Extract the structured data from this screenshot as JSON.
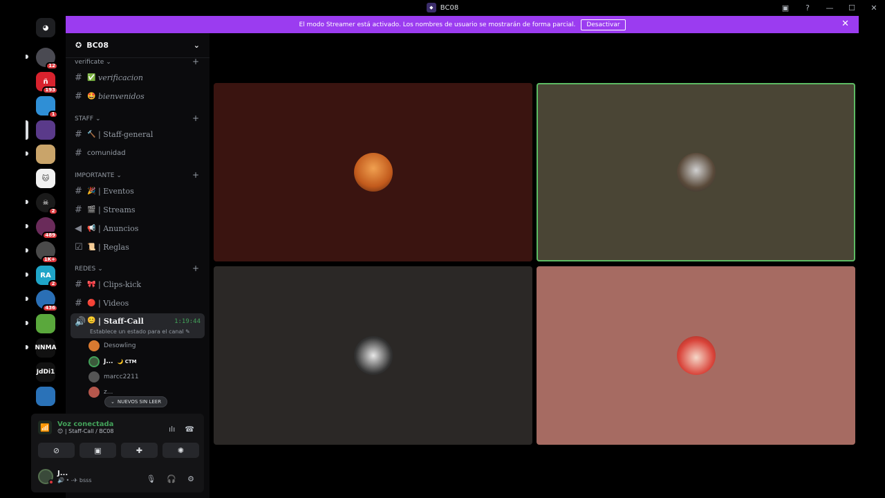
{
  "window": {
    "title": "BC08",
    "app_icon": "discord-server-icon"
  },
  "banner": {
    "text": "El modo Streamer está activado. Los nombres de usuario se mostrarán de forma parcial.",
    "button": "Desactivar",
    "color": "#9b3cf0"
  },
  "guilds": [
    {
      "name": "direct-messages",
      "label": "",
      "badge": ""
    },
    {
      "name": "server-1",
      "label": "",
      "badge": "12"
    },
    {
      "name": "server-2",
      "label": "",
      "badge": "193"
    },
    {
      "name": "server-3",
      "label": "",
      "badge": "1"
    },
    {
      "name": "server-bc08",
      "label": "",
      "badge": ""
    },
    {
      "name": "server-5",
      "label": "",
      "badge": ""
    },
    {
      "name": "server-6",
      "label": "",
      "badge": ""
    },
    {
      "name": "server-7",
      "label": "",
      "badge": "2"
    },
    {
      "name": "server-8",
      "label": "",
      "badge": "489"
    },
    {
      "name": "server-9",
      "label": "",
      "badge": "1K+"
    },
    {
      "name": "server-10",
      "label": "",
      "badge": "2"
    },
    {
      "name": "server-11",
      "label": "",
      "badge": "436"
    },
    {
      "name": "server-12",
      "label": "",
      "badge": ""
    },
    {
      "name": "server-13",
      "label": "NNMA",
      "badge": ""
    },
    {
      "name": "server-14",
      "label": "JdDi1",
      "badge": ""
    },
    {
      "name": "server-15",
      "label": "",
      "badge": ""
    }
  ],
  "sidebar": {
    "server_name": "BC08",
    "categories": {
      "verificate": "verificate",
      "staff": "STAFF",
      "importante": "IMPORTANTE",
      "redes": "REDES"
    },
    "channels": {
      "verificacion": {
        "emoji": "✅",
        "label": "verificacion"
      },
      "bienvenidos": {
        "emoji": "🤩",
        "label": "bienvenidos"
      },
      "staff_general": {
        "emoji": "🔨",
        "label": "| Staff-general"
      },
      "comunidad": {
        "emoji": "",
        "label": "comunidad"
      },
      "eventos": {
        "emoji": "🎉",
        "label": "| Eventos"
      },
      "streams": {
        "emoji": "🎬",
        "label": "| Streams"
      },
      "anuncios": {
        "emoji": "📢",
        "label": "| Anuncios"
      },
      "reglas": {
        "emoji": "📜",
        "label": "| Reglas"
      },
      "clips": {
        "emoji": "🎀",
        "label": "| Clips-kick"
      },
      "videos": {
        "emoji": "🔴",
        "label": "| Videos"
      },
      "staff_call": {
        "emoji": "😊",
        "label": "| Staff-Call",
        "timer": "1:19:44",
        "status": "Establece un estado para el canal"
      }
    },
    "voice_users": [
      {
        "name": "Desowling",
        "tag": ""
      },
      {
        "name": "J...",
        "tag": "🌙 CTM"
      },
      {
        "name": "marcc2211",
        "tag": ""
      },
      {
        "name": "z...",
        "tag": ""
      }
    ],
    "new_unread": "NUEVOS SIN LEER"
  },
  "panel": {
    "voice_status": "Voz conectada",
    "voice_channel": "😊 | Staff-Call / BC08",
    "user_name": "J...",
    "user_status": "🔊 • -✈ bsss"
  },
  "colors": {
    "tile_1": "#3a1410",
    "tile_2": "#4a4535",
    "tile_3": "#2b2826",
    "tile_4": "#a66b62",
    "speaking": "#5dbb63"
  }
}
